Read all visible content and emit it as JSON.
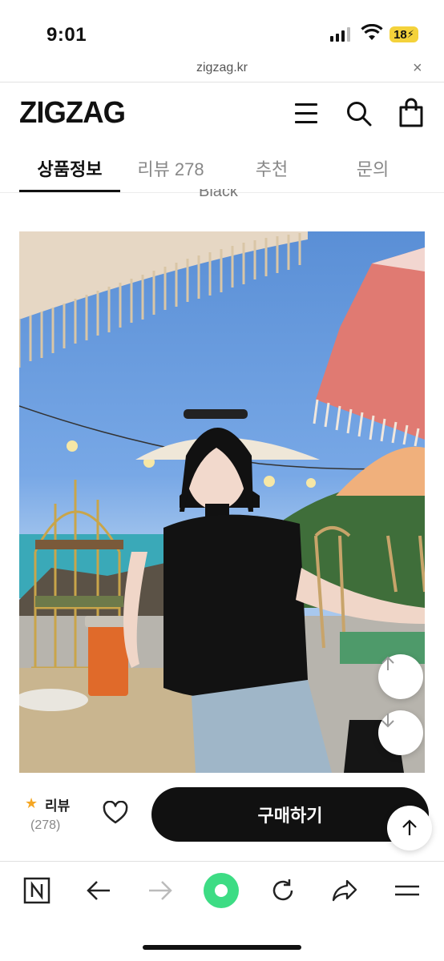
{
  "status_bar": {
    "time": "9:01",
    "battery": "18"
  },
  "browser": {
    "url": "zigzag.kr",
    "close_glyph": "×"
  },
  "header": {
    "logo": "ZIGZAG",
    "menu_icon": "menu-icon",
    "search_icon": "search-icon",
    "bag_icon": "shopping-bag-icon"
  },
  "tabs": [
    {
      "label": "상품정보",
      "active": true
    },
    {
      "label": "리뷰 278",
      "active": false
    },
    {
      "label": "추천",
      "active": false
    },
    {
      "label": "문의",
      "active": false
    }
  ],
  "partial_text": "Black",
  "bottom_bar": {
    "review_label": "리뷰",
    "review_count": "(278)",
    "buy_label": "구매하기"
  },
  "colors": {
    "accent": "#111111",
    "star": "#f5a623",
    "battery": "#f4d23b",
    "record": "#3ddc84"
  }
}
